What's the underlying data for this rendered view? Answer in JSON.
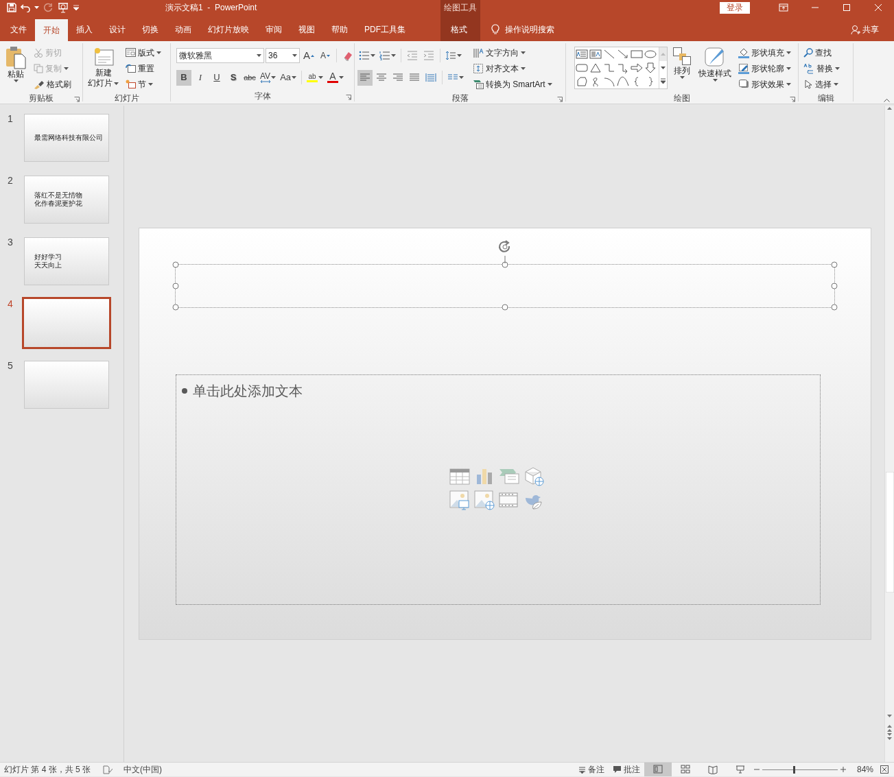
{
  "window": {
    "title": "演示文稿1  -  PowerPoint",
    "contextual_group": "绘图工具",
    "sign_in": "登录"
  },
  "tabs": [
    {
      "label": "文件",
      "selected": false
    },
    {
      "label": "开始",
      "selected": true
    },
    {
      "label": "插入",
      "selected": false
    },
    {
      "label": "设计",
      "selected": false
    },
    {
      "label": "切换",
      "selected": false
    },
    {
      "label": "动画",
      "selected": false
    },
    {
      "label": "幻灯片放映",
      "selected": false
    },
    {
      "label": "审阅",
      "selected": false
    },
    {
      "label": "视图",
      "selected": false
    },
    {
      "label": "帮助",
      "selected": false
    },
    {
      "label": "PDF工具集",
      "selected": false
    },
    {
      "label": "格式",
      "selected": false
    }
  ],
  "tell_me": "操作说明搜索",
  "share": "共享",
  "ribbon": {
    "clipboard": {
      "label": "剪贴板",
      "paste": "粘贴",
      "cut": {
        "label": "剪切",
        "disabled": true
      },
      "copy": {
        "label": "复制",
        "disabled": true
      },
      "format_painter": "格式刷"
    },
    "slides": {
      "label": "幻灯片",
      "new_slide": [
        "新建",
        "幻灯片"
      ],
      "layout": "版式",
      "reset": "重置",
      "section": "节"
    },
    "font": {
      "label": "字体",
      "font_name": "微软雅黑",
      "font_size": "36",
      "grow_font": "A",
      "shrink_font": "A",
      "bold": {
        "label": "B",
        "selected": true
      },
      "italic": "I",
      "underline": "U",
      "shadow": "S",
      "strikethrough": "abc",
      "spacing": "AV",
      "change_case": "Aa",
      "highlight": "ab",
      "font_color": "A"
    },
    "paragraph": {
      "label": "段落",
      "align_left": {
        "selected": true
      },
      "text_direction": "文字方向",
      "align_text": "对齐文本",
      "smartart": "转换为 SmartArt"
    },
    "drawing": {
      "label": "绘图",
      "arrange": "排列",
      "quick_styles": "快速样式",
      "fill": "形状填充",
      "outline": "形状轮廓",
      "effects": "形状效果"
    },
    "editing": {
      "label": "编辑",
      "find": "查找",
      "replace": "替换",
      "select": "选择"
    }
  },
  "slides": [
    {
      "number": "1",
      "lines": [
        "最需网络科技有限公司"
      ],
      "selected": false
    },
    {
      "number": "2",
      "lines": [
        "落红不是无情物",
        "化作春泥更护花"
      ],
      "selected": false
    },
    {
      "number": "3",
      "lines": [
        "好好学习",
        "天天向上"
      ],
      "selected": false
    },
    {
      "number": "4",
      "selected": true
    },
    {
      "number": "5",
      "selected": false
    }
  ],
  "slide": {
    "title_placeholder": {
      "selected": true
    },
    "content_placeholder": {
      "prompt": "单击此处添加文本"
    }
  },
  "status_bar": {
    "slide_info": "幻灯片 第 4 张，共 5 张",
    "language": "中文(中国)",
    "notes": "备注",
    "comments": "批注",
    "zoom": {
      "level": 0.42
    },
    "zoom_percent": "84%"
  }
}
